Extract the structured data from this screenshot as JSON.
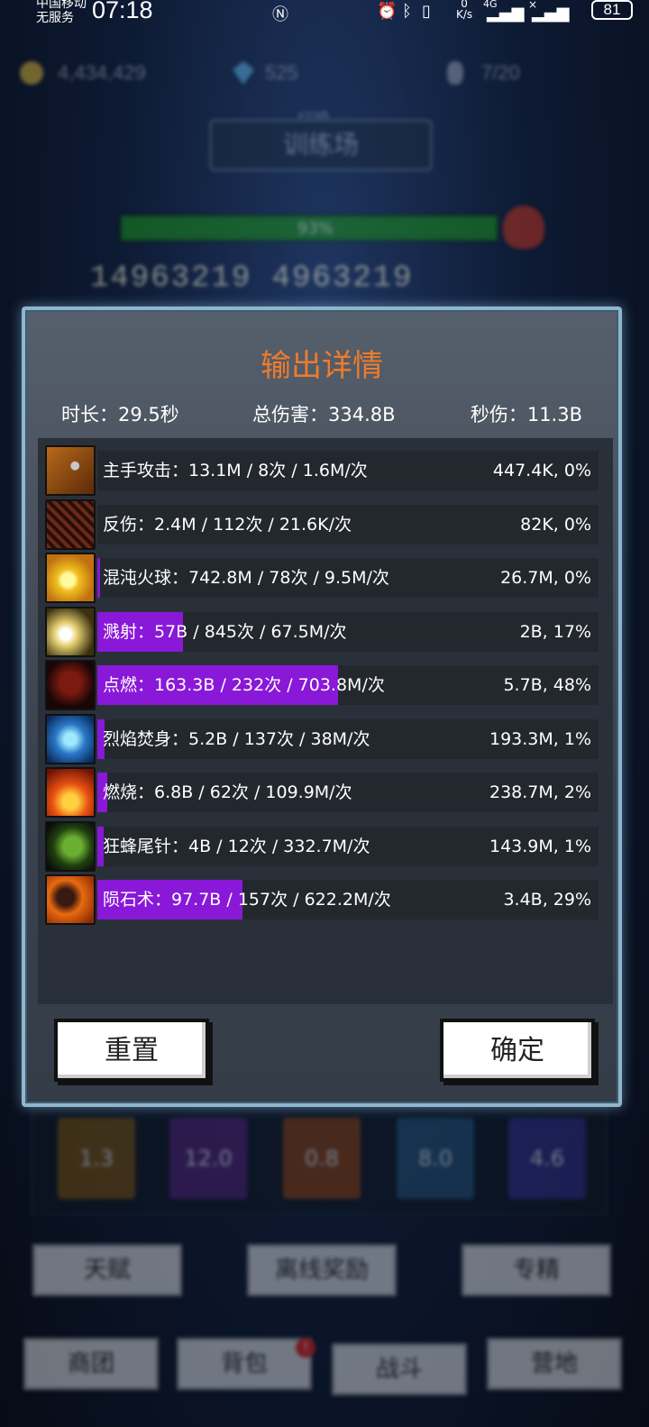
{
  "status_bar": {
    "carrier_line1": "中国移动",
    "carrier_line2": "无服务",
    "time": "07:18",
    "speed_value": "0",
    "speed_unit": "K/s",
    "network": "4G",
    "battery": "81"
  },
  "background": {
    "gold": "4,434,429",
    "gems": "525",
    "stamina": "7/20",
    "switch_label": "切换",
    "arena_button": "训练场",
    "hp_percent_label": "93%",
    "hp_percent": 93,
    "damage_floaters": "14963219 4963219",
    "skill_slots": [
      "1.3",
      "12.0",
      "0.8",
      "8.0",
      "4.6"
    ],
    "buttons_row1": [
      "天赋",
      "离线奖励",
      "专精"
    ],
    "buttons_row2": [
      "商团",
      "背包",
      "战斗",
      "营地"
    ],
    "bag_badge": "!"
  },
  "dialog": {
    "title": "输出详情",
    "duration": "时长：29.5秒",
    "total_damage": "总伤害：334.8B",
    "dps": "秒伤：11.3B",
    "rows": [
      {
        "icon": "sword-icon",
        "label": "主手攻击：13.1M  /  8次  /  1.6M/次",
        "right": "447.4K, 0%",
        "share": 0
      },
      {
        "icon": "thorns-icon",
        "label": "反伤：2.4M  /  112次  /  21.6K/次",
        "right": "82K, 0%",
        "share": 0
      },
      {
        "icon": "fireball-icon",
        "label": "混沌火球：742.8M  /  78次  /  9.5M/次",
        "right": "26.7M, 0%",
        "share": 0.5
      },
      {
        "icon": "splash-icon",
        "label": "溅射：57B  /  845次  /  67.5M/次",
        "right": "2B, 17%",
        "share": 17
      },
      {
        "icon": "ignite-icon",
        "label": "点燃：163.3B  /  232次  /  703.8M/次",
        "right": "5.7B, 48%",
        "share": 48
      },
      {
        "icon": "flame-body-icon",
        "label": "烈焰焚身：5.2B  /  137次  /  38M/次",
        "right": "193.3M, 1%",
        "share": 1.5
      },
      {
        "icon": "burn-icon",
        "label": "燃烧：6.8B  /  62次  /  109.9M/次",
        "right": "238.7M, 2%",
        "share": 2
      },
      {
        "icon": "wasp-stinger-icon",
        "label": "狂蜂尾针：4B  /  12次  /  332.7M/次",
        "right": "143.9M, 1%",
        "share": 1.2
      },
      {
        "icon": "meteor-icon",
        "label": "陨石术：97.7B  /  157次  /  622.2M/次",
        "right": "3.4B, 29%",
        "share": 29
      }
    ],
    "reset_button": "重置",
    "confirm_button": "确定"
  }
}
